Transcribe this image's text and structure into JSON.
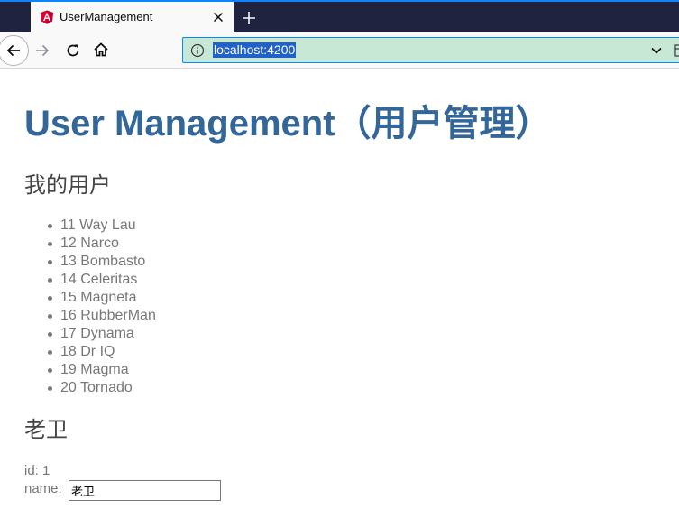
{
  "browser": {
    "tab_title": "UserManagement",
    "url": "localhost:4200",
    "colors": {
      "tabbar": "#202340",
      "active_tab": "#f9f9fa",
      "urlbar_bg": "#c6e8d4",
      "url_selection": "#2162c9"
    }
  },
  "page": {
    "title": "User Management（用户管理）",
    "my_users_heading": "我的用户",
    "users": [
      {
        "id": "11",
        "name": "Way Lau"
      },
      {
        "id": "12",
        "name": "Narco"
      },
      {
        "id": "13",
        "name": "Bombasto"
      },
      {
        "id": "14",
        "name": "Celeritas"
      },
      {
        "id": "15",
        "name": "Magneta"
      },
      {
        "id": "16",
        "name": "RubberMan"
      },
      {
        "id": "17",
        "name": "Dynama"
      },
      {
        "id": "18",
        "name": "Dr IQ"
      },
      {
        "id": "19",
        "name": "Magma"
      },
      {
        "id": "20",
        "name": "Tornado"
      }
    ],
    "detail": {
      "heading": "老卫",
      "id_label": "id:",
      "id_value": "1",
      "name_label": "name:",
      "name_value": "老卫"
    },
    "colors": {
      "title": "#336699",
      "heading": "#444444",
      "text": "#777777"
    }
  }
}
